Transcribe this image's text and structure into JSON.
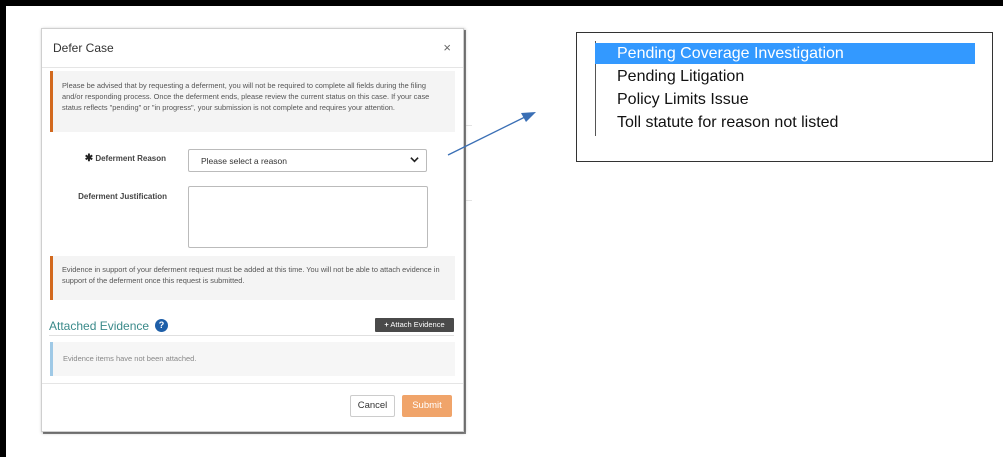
{
  "modal": {
    "title": "Defer Case",
    "close_glyph": "×",
    "notice_text": "Please be advised that by requesting a deferment, you will not be required to complete all fields during the filing and/or responding process. Once the deferment ends, please review the current status on this case. If your case status reflects \"pending\" or \"in progress\", your submission is not complete and requires your attention.",
    "reason_label": "Deferment Reason",
    "required_glyph": "✱",
    "reason_select_value": "Please select a reason",
    "justification_label": "Deferment Justification",
    "justification_value": "",
    "evidence_notice_text": "Evidence in support of your deferment request must be added at this time. You will not be able to attach evidence in support of the deferment once this request is submitted.",
    "attached_evidence_title": "Attached Evidence",
    "attach_button_label": "Attach Evidence",
    "attach_button_icon": "+",
    "no_evidence_text": "Evidence items have not been attached.",
    "cancel_label": "Cancel",
    "submit_label": "Submit"
  },
  "dropdown_options": [
    {
      "label": "Pending Coverage Investigation",
      "selected": true
    },
    {
      "label": "Pending Litigation",
      "selected": false
    },
    {
      "label": "Policy Limits Issue",
      "selected": false
    },
    {
      "label": "Toll statute for reason not listed",
      "selected": false
    }
  ],
  "colors": {
    "accent_orange": "#d2691e",
    "submit_bg": "#f0a46a",
    "teal_title": "#3a8a8a",
    "help_icon": "#1e5fa8",
    "selected_option": "#3399ff",
    "arrow": "#3a6fb5"
  }
}
